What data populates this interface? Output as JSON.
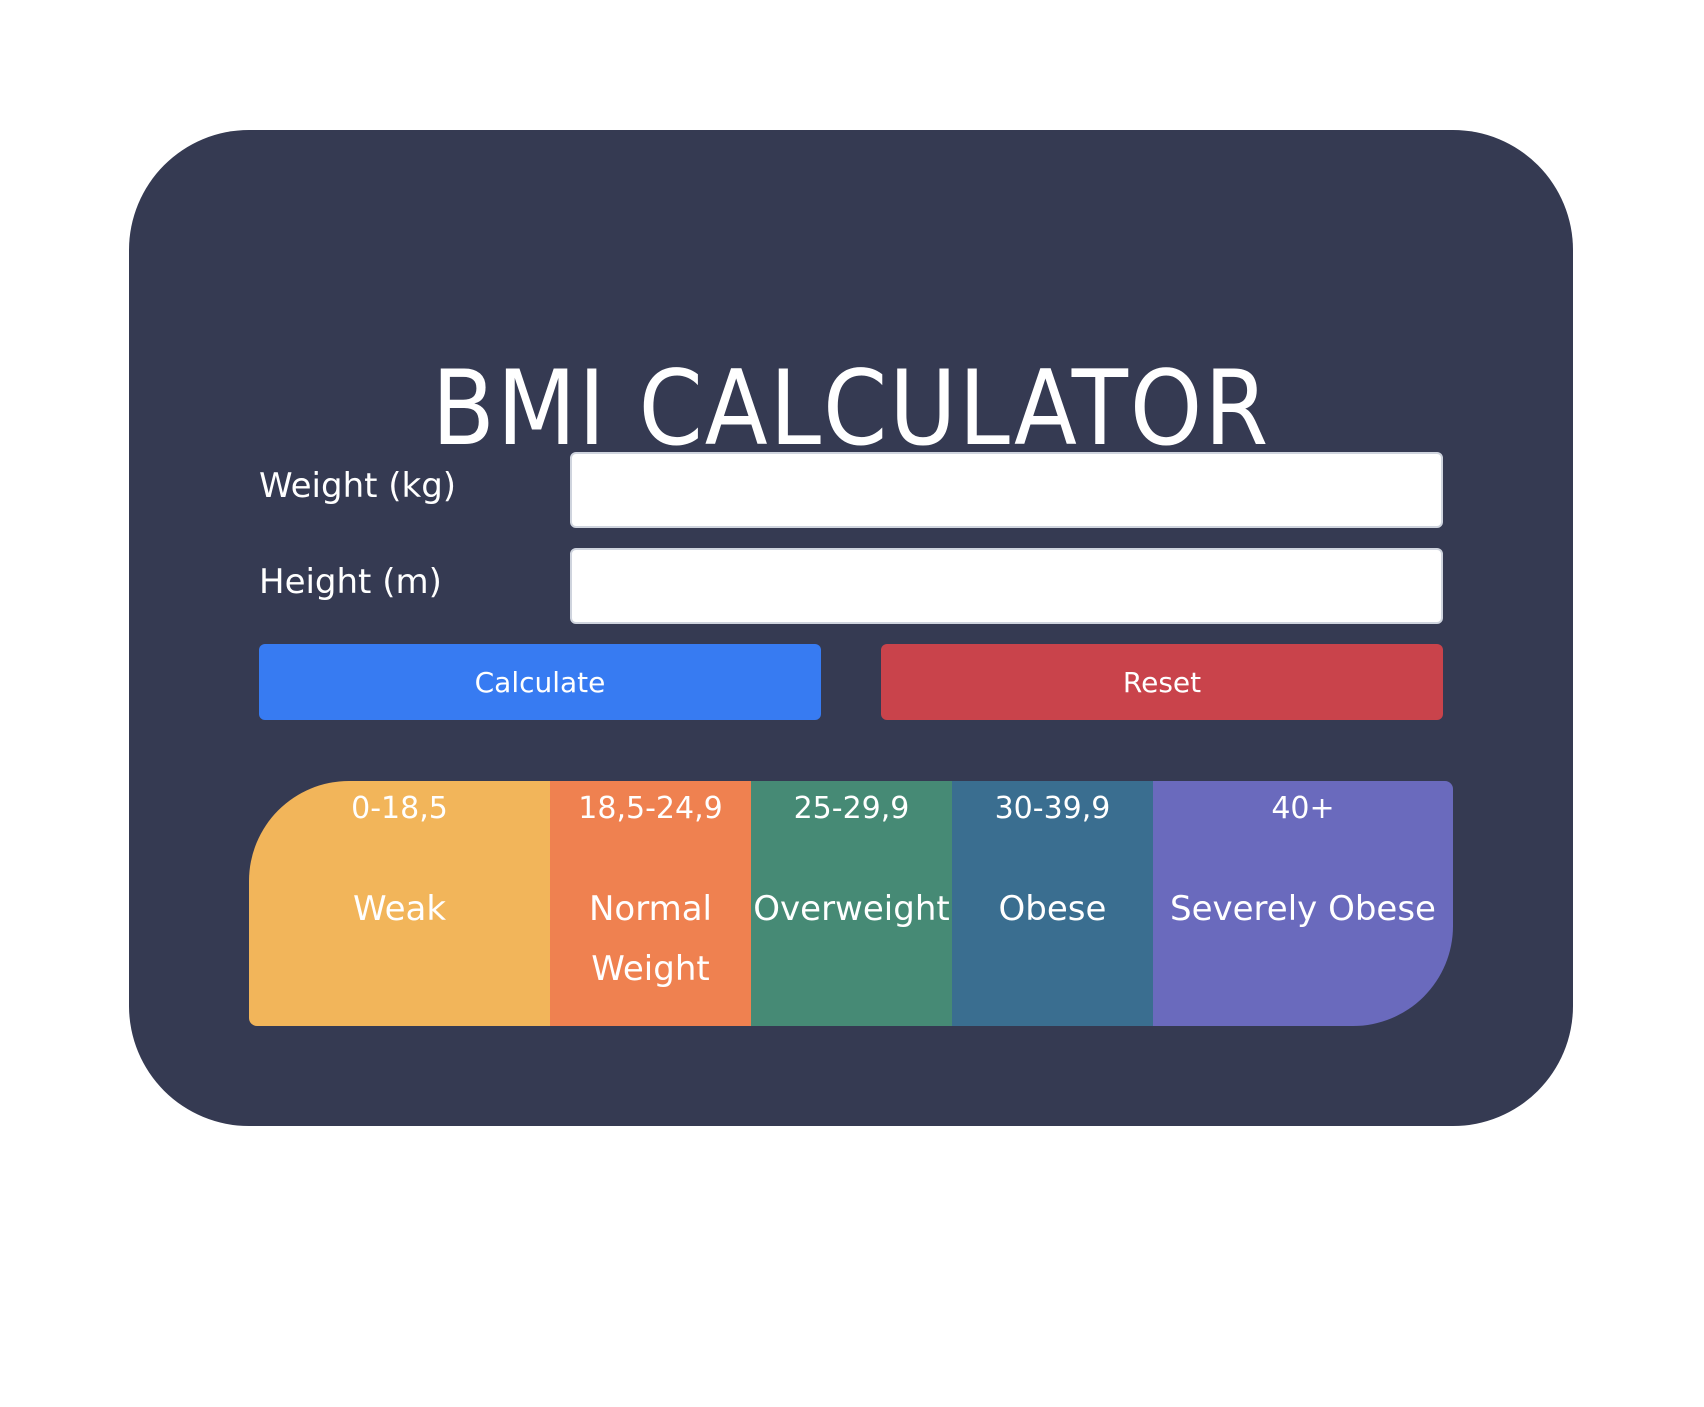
{
  "app": {
    "title": "BMI CALCULATOR"
  },
  "form": {
    "weight_label": "Weight (kg)",
    "weight_value": "",
    "height_label": "Height (m)",
    "height_value": ""
  },
  "buttons": {
    "calculate_label": "Calculate",
    "reset_label": "Reset"
  },
  "scale": [
    {
      "range": "0-18,5",
      "name": "Weak",
      "color": "#f2b55a"
    },
    {
      "range": "18,5-24,9",
      "name": "Normal Weight",
      "color": "#ef8150"
    },
    {
      "range": "25-29,9",
      "name": "Overweight",
      "color": "#468a75"
    },
    {
      "range": "30-39,9",
      "name": "Obese",
      "color": "#3a6e90"
    },
    {
      "range": "40+",
      "name": "Severely Obese",
      "color": "#6a6abd"
    }
  ],
  "colors": {
    "card_background": "#353a52",
    "calculate_button": "#377bf2",
    "reset_button": "#c9434b"
  }
}
